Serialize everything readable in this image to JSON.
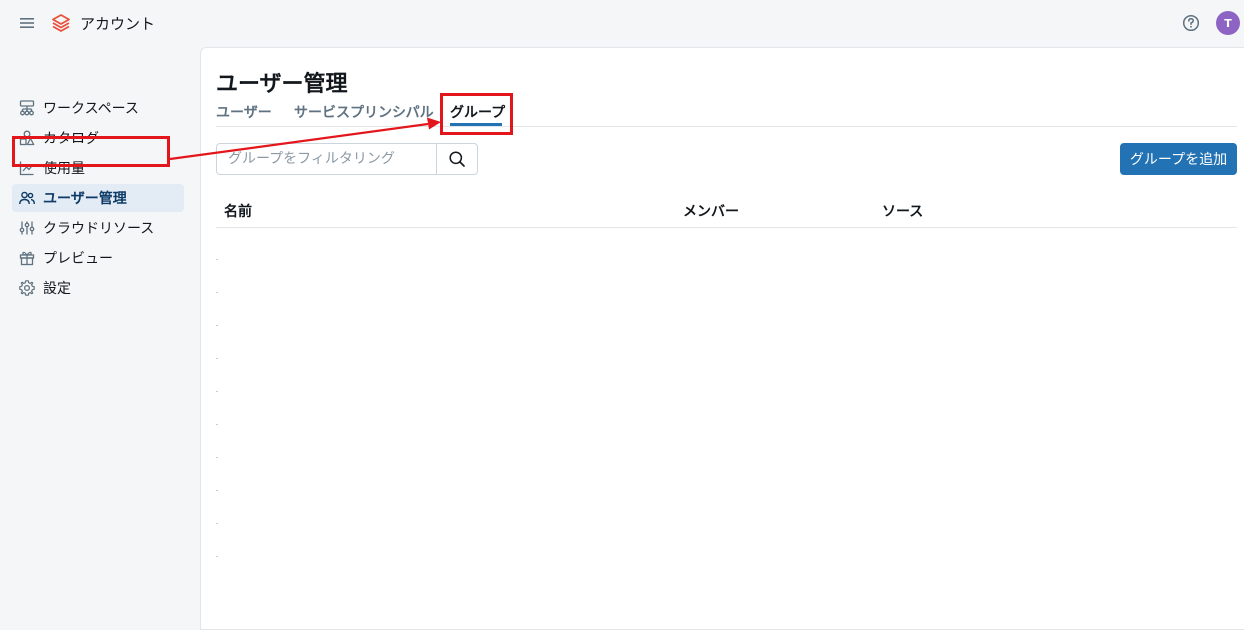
{
  "header": {
    "app_title": "アカウント",
    "avatar_initial": "T",
    "brand_color": "#e8513b"
  },
  "sidebar": {
    "items": [
      {
        "label": "ワークスペース",
        "icon": "workspace-icon"
      },
      {
        "label": "カタログ",
        "icon": "catalog-icon"
      },
      {
        "label": "使用量",
        "icon": "usage-chart-icon"
      },
      {
        "label": "ユーザー管理",
        "icon": "users-icon",
        "active": true
      },
      {
        "label": "クラウドリソース",
        "icon": "cloud-resources-icon"
      },
      {
        "label": "プレビュー",
        "icon": "gift-icon"
      },
      {
        "label": "設定",
        "icon": "gear-icon"
      }
    ]
  },
  "main": {
    "title": "ユーザー管理",
    "tabs": [
      {
        "label": "ユーザー"
      },
      {
        "label": "サービスプリンシパル"
      },
      {
        "label": "グループ",
        "active": true
      }
    ],
    "search": {
      "placeholder": "グループをフィルタリング"
    },
    "add_button": "グループを追加",
    "table": {
      "columns": [
        "名前",
        "メンバー",
        "ソース"
      ]
    }
  },
  "colors": {
    "accent": "#2272b4",
    "highlight": "#e3161b",
    "avatar": "#8d64c4"
  }
}
